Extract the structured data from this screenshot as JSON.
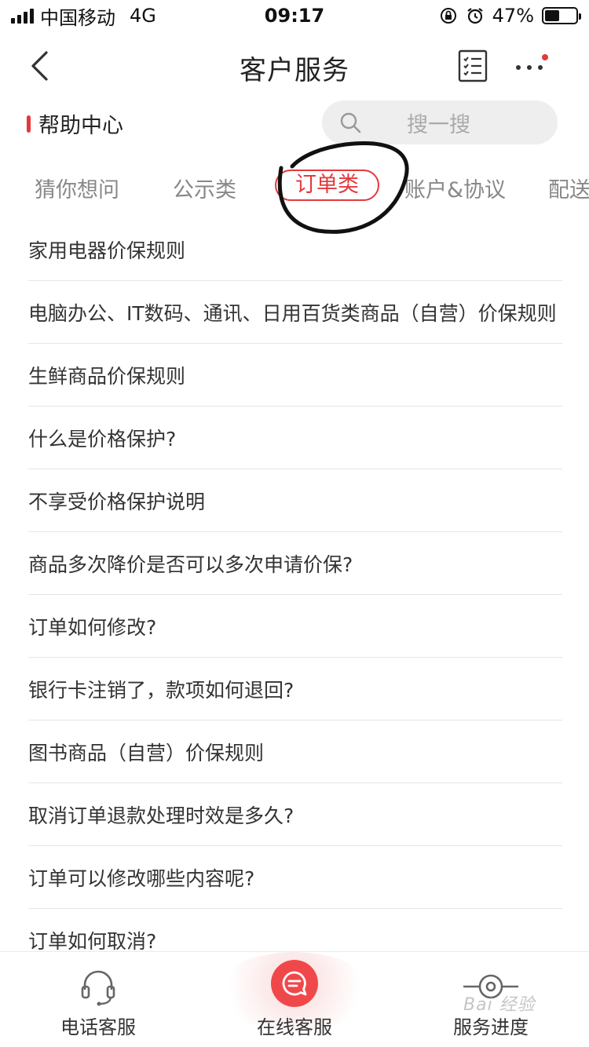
{
  "status_bar": {
    "carrier": "中国移动",
    "network": "4G",
    "time": "09:17",
    "battery": "47%",
    "battery_level": 0.47
  },
  "nav": {
    "title": "客户服务",
    "back_icon": "chevron-left-icon",
    "list_icon": "checklist-icon",
    "more_icon": "more-dots-icon",
    "notification_color": "#e4393c"
  },
  "help": {
    "title": "帮助中心",
    "search_placeholder": "搜一搜"
  },
  "tabs": [
    {
      "label": "猜你想问",
      "active": false
    },
    {
      "label": "公示类",
      "active": false
    },
    {
      "label": "订单类",
      "active": true
    },
    {
      "label": "账户&协议",
      "active": false
    },
    {
      "label": "配送",
      "active": false
    }
  ],
  "faq": [
    "家用电器价保规则",
    "电脑办公、IT数码、通讯、日用百货类商品（自营）价保规则",
    "生鲜商品价保规则",
    "什么是价格保护?",
    "不享受价格保护说明",
    "商品多次降价是否可以多次申请价保?",
    "订单如何修改?",
    "银行卡注销了，款项如何退回?",
    "图书商品（自营）价保规则",
    "取消订单退款处理时效是多久?",
    "订单可以修改哪些内容呢?",
    "订单如何取消?"
  ],
  "bottom_bar": {
    "phone": "电话客服",
    "online": "在线客服",
    "progress": "服务进度"
  },
  "colors": {
    "accent": "#e4393c",
    "online_button": "#f0484a"
  },
  "watermark": "Bai 经验"
}
